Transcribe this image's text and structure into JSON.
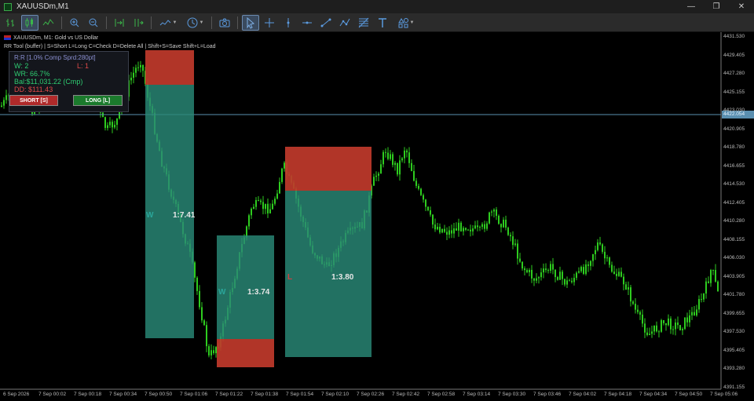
{
  "window": {
    "title": "XAUUSDm,M1",
    "minimize": "—",
    "restore": "❐",
    "close": "✕"
  },
  "toolbar": {
    "items": [
      {
        "icon": "bar-chart-icon",
        "active": false
      },
      {
        "icon": "candlestick-chart-icon",
        "active": true
      },
      {
        "icon": "line-chart-icon",
        "active": false
      },
      {
        "icon": "zoom-in-icon",
        "active": false
      },
      {
        "icon": "zoom-out-icon",
        "active": false
      },
      {
        "icon": "chart-shift-icon",
        "active": false
      },
      {
        "icon": "auto-scroll-icon",
        "active": false
      },
      {
        "icon": "indicators-icon",
        "active": false,
        "dropdown": true
      },
      {
        "icon": "timeframe-clock-icon",
        "active": false,
        "dropdown": true
      },
      {
        "icon": "screenshot-camera-icon",
        "active": false
      },
      {
        "icon": "cursor-arrow-icon",
        "active": true
      },
      {
        "icon": "crosshair-icon",
        "active": false
      },
      {
        "icon": "vertical-line-icon",
        "active": false
      },
      {
        "icon": "horizontal-line-icon",
        "active": false
      },
      {
        "icon": "trend-line-icon",
        "active": false
      },
      {
        "icon": "pattern-tool-icon",
        "active": false
      },
      {
        "icon": "fibonacci-icon",
        "active": false
      },
      {
        "icon": "text-tool-icon",
        "active": false
      },
      {
        "icon": "shapes-icon",
        "active": false,
        "dropdown": true
      }
    ]
  },
  "chart": {
    "symbol_line": "XAUUSDm, M1:  Gold vs US Dollar",
    "hotkeys_line": "RR Tool (buffer)  |  S=Short  L=Long  C=Check  D=Delete All  |  Shift+S=Save  Shift+L=Load",
    "current_price": "4422.054",
    "price_labels": [
      "4431.530",
      "4429.405",
      "4427.280",
      "4425.155",
      "4423.030",
      "4420.905",
      "4418.780",
      "4416.655",
      "4414.530",
      "4412.405",
      "4410.280",
      "4408.155",
      "4406.030",
      "4403.905",
      "4401.780",
      "4399.655",
      "4397.530",
      "4395.405",
      "4393.280",
      "4391.155"
    ],
    "time_labels": [
      "6 Sep 2026",
      "7 Sep 00:02",
      "7 Sep 00:18",
      "7 Sep 00:34",
      "7 Sep 00:50",
      "7 Sep 01:06",
      "7 Sep 01:22",
      "7 Sep 01:38",
      "7 Sep 01:54",
      "7 Sep 02:10",
      "7 Sep 02:26",
      "7 Sep 02:42",
      "7 Sep 02:58",
      "7 Sep 03:14",
      "7 Sep 03:30",
      "7 Sep 03:46",
      "7 Sep 04:02",
      "7 Sep 04:18",
      "7 Sep 04:34",
      "7 Sep 04:50",
      "7 Sep 05:06"
    ],
    "colors": {
      "candle": "#2ecc1f",
      "tp_zone": "#2a8a78",
      "sl_zone": "#c0392b",
      "win": "#2aa69a",
      "loss": "#d04040",
      "price_line": "#5a8fb0"
    }
  },
  "panel": {
    "rr_line": "R:R  [1.0% Comp  Sprd:280pt]",
    "wins": "W: 2",
    "losses": "L: 1",
    "win_rate": "WR: 66.7%",
    "balance": "Bal:$11,031.22 (Cmp)",
    "drawdown": "DD: $111.43",
    "short_button": "SHORT  [S]",
    "long_button": "LONG  [L]"
  },
  "trades": [
    {
      "result": "W",
      "ratio": "1:7.41"
    },
    {
      "result": "W",
      "ratio": "1:3.74"
    },
    {
      "result": "L",
      "ratio": "1:3.80"
    }
  ]
}
